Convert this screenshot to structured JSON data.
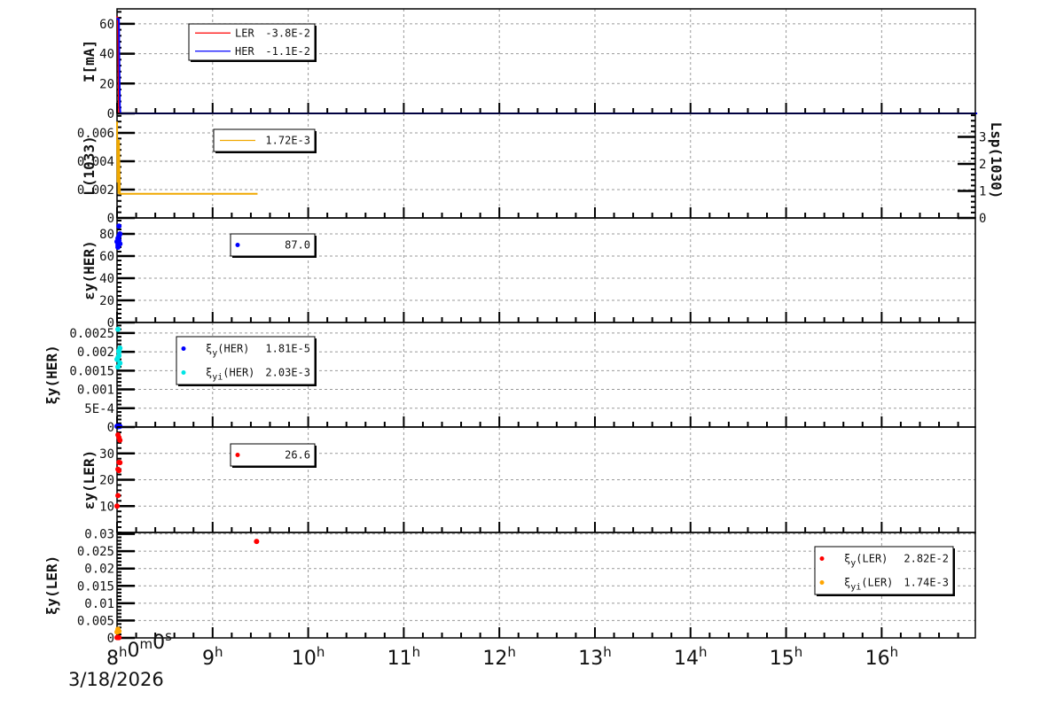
{
  "chart_data": [
    {
      "type": "line",
      "ylabel": "I[mA]",
      "ylim": [
        0,
        70
      ],
      "yticks": [
        "0",
        "20",
        "40",
        "60"
      ],
      "ytick_values": [
        0,
        20,
        40,
        60
      ],
      "series": [
        {
          "name": "LER",
          "legend_value": "-3.8E-2",
          "color": "#ff0000",
          "style": "line",
          "x": [
            8.0,
            8.01,
            8.02
          ],
          "y": [
            65,
            63,
            0
          ]
        },
        {
          "name": "HER",
          "legend_value": "-1.1E-2",
          "color": "#0000ff",
          "style": "line",
          "x": [
            8.0,
            8.01,
            8.02,
            8.025,
            8.03,
            8.035,
            17.0
          ],
          "y": [
            64,
            63,
            63,
            31,
            5,
            0,
            0
          ]
        }
      ]
    },
    {
      "type": "line",
      "ylabel": "L(10^33)",
      "ylim": [
        0,
        0.007375
      ],
      "yticks": [
        "0",
        "0.002",
        "0.004",
        "0.006"
      ],
      "ytick_values": [
        0,
        0.002,
        0.004,
        0.006
      ],
      "right_axis": {
        "label": "Lsp(10^30)",
        "ylim": [
          0,
          3.87
        ],
        "ticks": [
          "0",
          "1",
          "2",
          "3"
        ],
        "tick_values": [
          0,
          1,
          2,
          3
        ]
      },
      "series": [
        {
          "name": "",
          "legend_value": "1.72E-3",
          "legend_overlap": "1.0",
          "color": "#f0a800",
          "style": "line",
          "x": [
            8.0,
            8.005,
            8.01,
            8.015,
            8.02,
            8.03,
            9.47
          ],
          "y": [
            0.0068,
            0.0025,
            0.0043,
            0.0017,
            0.0055,
            0.0017,
            0.0017
          ]
        }
      ]
    },
    {
      "type": "scatter",
      "ylabel": "εy(HER)",
      "ylim": [
        0,
        94.4
      ],
      "yticks": [
        "0",
        "20",
        "40",
        "60",
        "80"
      ],
      "ytick_values": [
        0,
        20,
        40,
        60,
        80
      ],
      "series": [
        {
          "name": "",
          "legend_value": "87.0",
          "color": "#0000ff",
          "style": "points",
          "x": [
            8.0,
            8.01,
            8.02,
            8.03,
            8.02,
            8.01,
            8.03,
            8.02,
            8.01
          ],
          "y": [
            73,
            68,
            87,
            80,
            78,
            76,
            71,
            74,
            70
          ]
        }
      ]
    },
    {
      "type": "scatter",
      "ylabel": "ξy(HER)",
      "ylim": [
        0,
        0.00278
      ],
      "yticks": [
        "0",
        "5E-4",
        "0.001",
        "0.0015",
        "0.002",
        "0.0025"
      ],
      "ytick_values": [
        0,
        0.0005,
        0.001,
        0.0015,
        0.002,
        0.0025
      ],
      "series": [
        {
          "name": "ξy(HER)",
          "legend_value": "1.81E-5",
          "color": "#0000ff",
          "style": "points",
          "x": [
            8.0,
            8.01,
            8.02,
            8.03
          ],
          "y": [
            2e-05,
            1e-05,
            2e-05,
            1.81e-05
          ]
        },
        {
          "name": "ξyi(HER)",
          "legend_value": "2.03E-3",
          "color": "#00e5e5",
          "style": "points",
          "x": [
            8.01,
            8.0,
            8.02,
            8.03,
            8.01,
            8.02,
            8.03,
            8.01,
            8.02
          ],
          "y": [
            0.0026,
            0.0018,
            0.002,
            0.0021,
            0.0016,
            0.0019,
            0.0017,
            0.00185,
            0.00203
          ]
        }
      ]
    },
    {
      "type": "scatter",
      "ylabel": "εy(LER)",
      "ylim": [
        0,
        40
      ],
      "yticks": [
        "10",
        "20",
        "30"
      ],
      "ytick_values": [
        10,
        20,
        30
      ],
      "series": [
        {
          "name": "",
          "legend_value": "26.6",
          "color": "#ff0000",
          "style": "points",
          "x": [
            8.0,
            8.01,
            8.02,
            8.03,
            8.02,
            8.03,
            8.01,
            8.02,
            8.01
          ],
          "y": [
            10,
            14,
            36,
            35,
            26.6,
            26.5,
            24,
            23.5,
            37
          ]
        }
      ]
    },
    {
      "type": "scatter",
      "ylabel": "ξy(LER)",
      "ylim": [
        0,
        0.0304
      ],
      "yticks": [
        "0",
        "0.005",
        "0.01",
        "0.015",
        "0.02",
        "0.025",
        "0.03"
      ],
      "ytick_values": [
        0,
        0.005,
        0.01,
        0.015,
        0.02,
        0.025,
        0.03
      ],
      "series": [
        {
          "name": "ξy(LER)",
          "legend_value": "2.82E-2",
          "color": "#ff0000",
          "style": "points",
          "x": [
            8.0,
            8.01,
            8.02,
            9.46
          ],
          "y": [
            0.0001,
            0.0001,
            0.0001,
            0.0278
          ]
        },
        {
          "name": "ξyi(LER)",
          "legend_value": "1.74E-3",
          "color": "#ffa500",
          "style": "points",
          "x": [
            8.0,
            8.01,
            8.02
          ],
          "y": [
            0.0017,
            0.0025,
            0.0019
          ]
        }
      ]
    }
  ],
  "x_axis": {
    "xlim": [
      8.0,
      16.98
    ],
    "major": [
      8,
      9,
      10,
      11,
      12,
      13,
      14,
      15,
      16
    ],
    "labels": [
      "8h0m0s",
      "9h",
      "10h",
      "11h",
      "12h",
      "13h",
      "14h",
      "15h",
      "16h"
    ],
    "date": "3/18/2026"
  },
  "grid": true
}
